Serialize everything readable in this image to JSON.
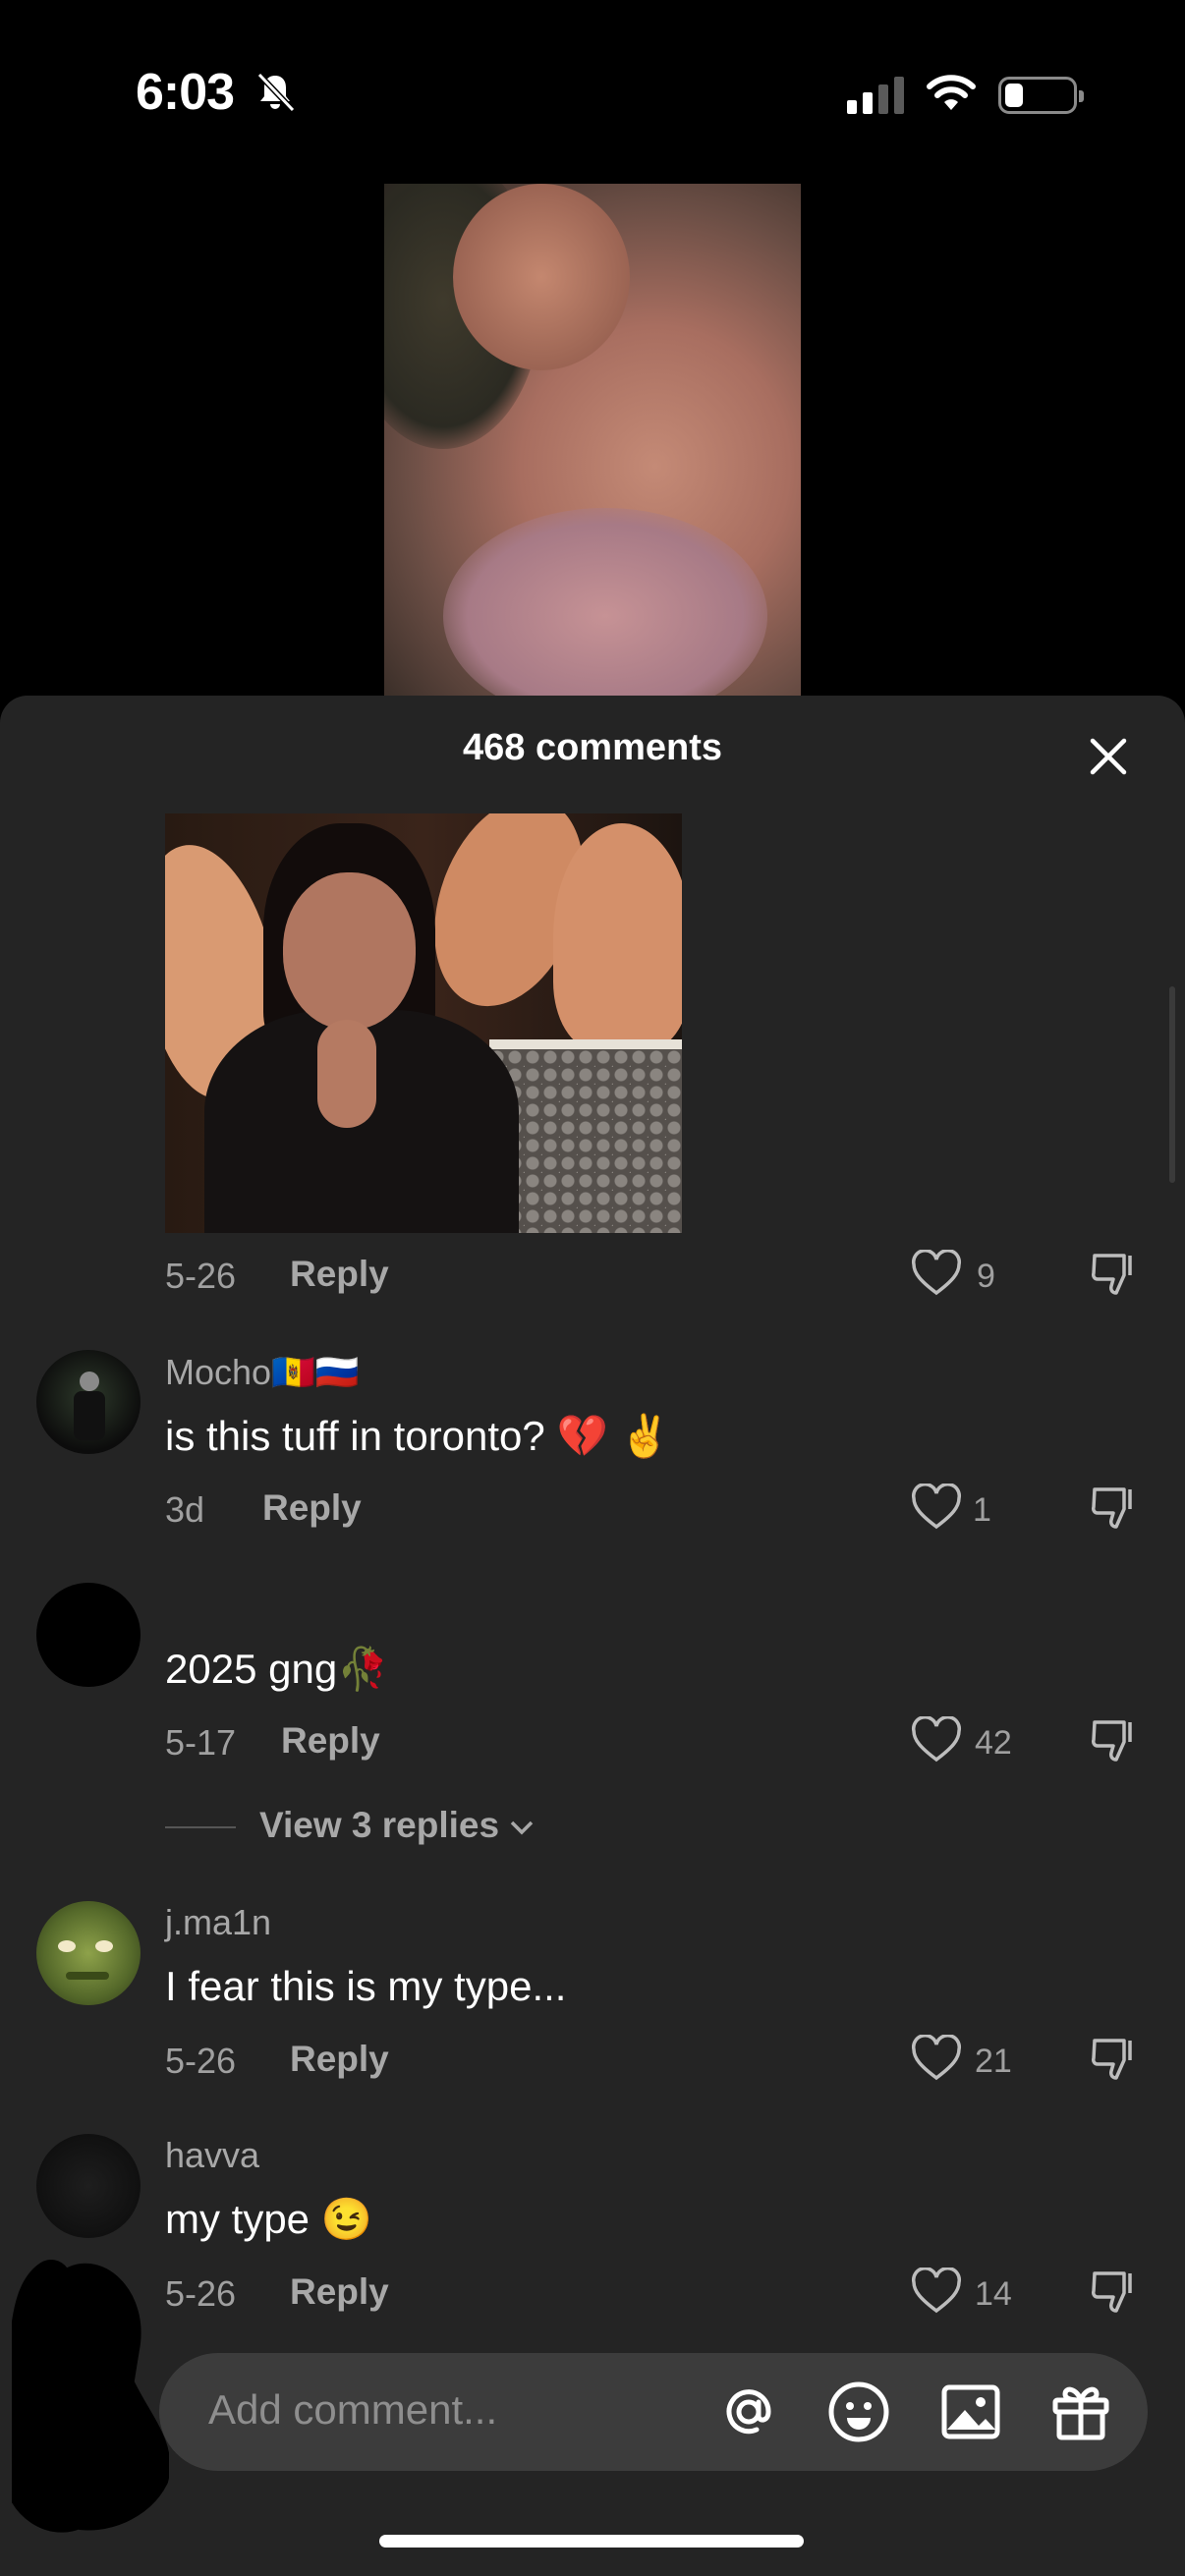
{
  "status_bar": {
    "time": "6:03",
    "icons": [
      "bell-slash-icon",
      "cellular-signal-icon",
      "wifi-icon",
      "battery-icon"
    ]
  },
  "sheet": {
    "title": "468 comments"
  },
  "comments": [
    {
      "id": "c0",
      "username": "",
      "text": "",
      "date": "5-26",
      "reply_label": "Reply",
      "likes": "9"
    },
    {
      "id": "c1",
      "username": "Mocho",
      "flags": "🇲🇩🇷🇺",
      "text": "is this tuff in toronto?",
      "emoji": "💔 ✌️",
      "date": "3d",
      "reply_label": "Reply",
      "likes": "1"
    },
    {
      "id": "c2",
      "username": "",
      "text": "2025 gng",
      "emoji": "🥀",
      "date": "5-17",
      "reply_label": "Reply",
      "likes": "42",
      "view_replies": "View 3 replies"
    },
    {
      "id": "c3",
      "username": "j.ma1n",
      "text": "I fear this is my type...",
      "date": "5-26",
      "reply_label": "Reply",
      "likes": "21"
    },
    {
      "id": "c4",
      "username": "havva",
      "text": "my type",
      "emoji": "😉",
      "date": "5-26",
      "reply_label": "Reply",
      "likes": "14"
    }
  ],
  "input": {
    "placeholder": "Add comment...",
    "icons": [
      "at-icon",
      "emoji-icon",
      "image-icon",
      "gift-icon"
    ]
  },
  "colors": {
    "sheet_bg": "#242424",
    "input_bg": "#3c3c3c",
    "muted_text": "#a0a0a0"
  }
}
